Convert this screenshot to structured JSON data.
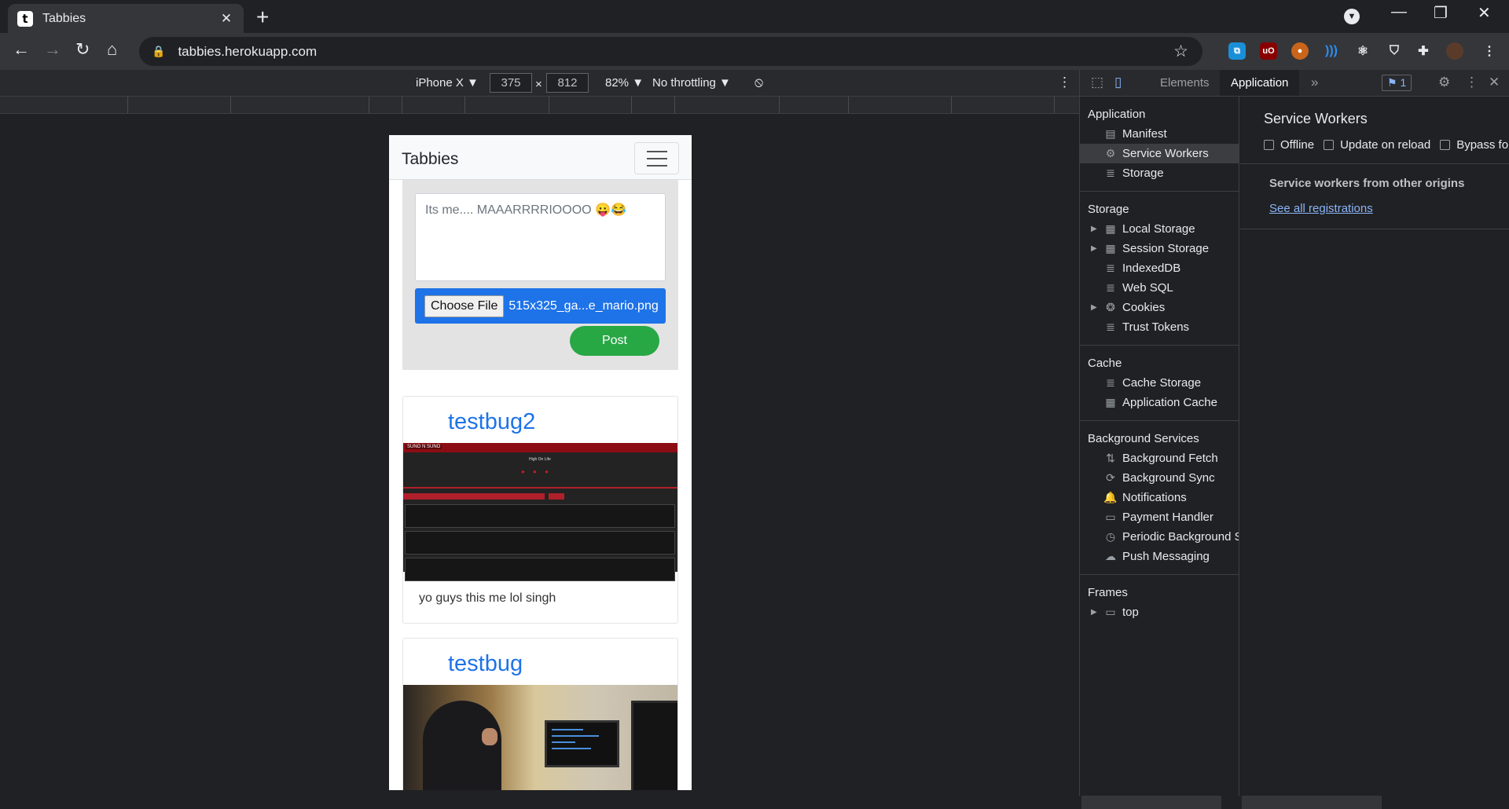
{
  "browser": {
    "tab_title": "Tabbies",
    "tab_favicon": "t",
    "url": "tabbies.herokuapp.com"
  },
  "device_toolbar": {
    "device": "iPhone X ▼",
    "width": "375",
    "height": "812",
    "times": "×",
    "zoom": "82% ▼",
    "throttling": "No throttling ▼"
  },
  "page": {
    "brand": "Tabbies",
    "composer": {
      "text": "Its me.... MAAARRRRIOOOO 😛😂",
      "choose_file_label": "Choose File",
      "file_name": "515x325_ga...e_mario.png",
      "post_label": "Post"
    },
    "posts": [
      {
        "user": "testbug2",
        "text": "yo guys this me lol singh"
      },
      {
        "user": "testbug",
        "text": ""
      }
    ],
    "shot1": {
      "header": "SUNO N SUNO",
      "title": "High On Life",
      "dots": "● ● ●"
    }
  },
  "devtools": {
    "tabs": [
      "Elements",
      "Application"
    ],
    "active_tab": "Application",
    "issues_count": "1",
    "sidebar": {
      "application": {
        "label": "Application",
        "items": [
          "Manifest",
          "Service Workers",
          "Storage"
        ]
      },
      "storage": {
        "label": "Storage",
        "items": [
          "Local Storage",
          "Session Storage",
          "IndexedDB",
          "Web SQL",
          "Cookies",
          "Trust Tokens"
        ]
      },
      "cache": {
        "label": "Cache",
        "items": [
          "Cache Storage",
          "Application Cache"
        ]
      },
      "background": {
        "label": "Background Services",
        "items": [
          "Background Fetch",
          "Background Sync",
          "Notifications",
          "Payment Handler",
          "Periodic Background S",
          "Push Messaging"
        ]
      },
      "frames": {
        "label": "Frames",
        "items": [
          "top"
        ]
      }
    },
    "service_workers": {
      "title": "Service Workers",
      "options": [
        "Offline",
        "Update on reload",
        "Bypass fo"
      ],
      "other_origins": "Service workers from other origins",
      "see_all": "See all registrations"
    }
  },
  "colors": {
    "accent": "#1e73e8",
    "post_green": "#28a745",
    "devtools_bg": "#202124"
  }
}
